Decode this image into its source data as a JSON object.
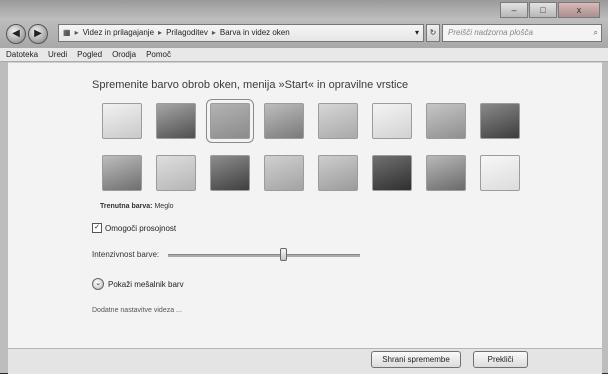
{
  "window": {
    "controls": {
      "minimize": "–",
      "maximize": "□",
      "close": "x"
    },
    "nav": {
      "back_icon": "back-arrow-icon",
      "forward_icon": "forward-arrow-icon"
    },
    "breadcrumb": [
      "Videz in prilagajanje",
      "Prilagoditev",
      "Barva in videz oken"
    ],
    "search_placeholder": "Preišči nadzorna plošča"
  },
  "menubar": [
    "Datoteka",
    "Uredi",
    "Pogled",
    "Orodja",
    "Pomoč"
  ],
  "heading": "Spremenite barvo obrob oken, menija »Start« in opravilne vrstice",
  "swatches": {
    "row1": [
      {
        "top": "#f2f2f2",
        "bottom": "#c9c9c9"
      },
      {
        "top": "#a6a6a6",
        "bottom": "#4f4f4f"
      },
      {
        "top": "#b3b3b3",
        "bottom": "#8b8b8b"
      },
      {
        "top": "#bdbdbd",
        "bottom": "#7a7a7a"
      },
      {
        "top": "#d6d6d6",
        "bottom": "#a9a9a9"
      },
      {
        "top": "#f4f4f4",
        "bottom": "#d2d2d2"
      },
      {
        "top": "#c6c6c6",
        "bottom": "#8f8f8f"
      },
      {
        "top": "#8a8a8a",
        "bottom": "#3d3d3d"
      }
    ],
    "row2": [
      {
        "top": "#bdbdbd",
        "bottom": "#6e6e6e"
      },
      {
        "top": "#dedede",
        "bottom": "#b5b5b5"
      },
      {
        "top": "#8d8d8d",
        "bottom": "#3f3f3f"
      },
      {
        "top": "#d0d0d0",
        "bottom": "#a3a3a3"
      },
      {
        "top": "#cdcdcd",
        "bottom": "#9b9b9b"
      },
      {
        "top": "#707070",
        "bottom": "#2f2f2f"
      },
      {
        "top": "#b9b9b9",
        "bottom": "#6a6a6a"
      },
      {
        "top": "#f7f7f7",
        "bottom": "#dcdcdc"
      }
    ],
    "selected_index": 2
  },
  "current_color_label": "Trenutna barva:",
  "current_color_value": "Meglo",
  "transparency": {
    "label": "Omogoči prosojnost",
    "checked": true,
    "check_glyph": "✓"
  },
  "intensity": {
    "label": "Intenzivnost barve:",
    "value_percent": 60
  },
  "mixer": {
    "label": "Pokaži mešalnik barv",
    "icon": "expand-chevron-icon",
    "glyph": "⌄"
  },
  "advanced_link": "Dodatne nastavitve videza ...",
  "buttons": {
    "save": "Shrani spremembe",
    "cancel": "Prekliči"
  }
}
